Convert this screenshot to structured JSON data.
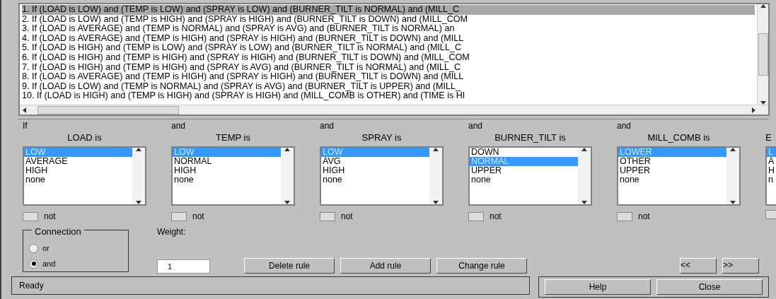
{
  "rules": [
    {
      "text": "1. If (LOAD is LOW) and (TEMP is LOW) and (SPRAY is LOW) and (BURNER_TILT is NORMAL) and (MILL_C",
      "selected": true
    },
    {
      "text": "2. If (LOAD is LOW) and (TEMP is HIGH) and (SPRAY is HIGH) and (BURNER_TILT is DOWN) and (MILL_COM",
      "selected": false
    },
    {
      "text": "3. If (LOAD is AVERAGE) and (TEMP is NORMAL) and (SPRAY is AVG) and (BURNER_TILT is NORMAL) an",
      "selected": false
    },
    {
      "text": "4. If (LOAD is AVERAGE) and (TEMP is HIGH) and (SPRAY is HIGH) and (BURNER_TILT is DOWN) and (MILL",
      "selected": false
    },
    {
      "text": "5. If (LOAD is HIGH) and (TEMP is LOW) and (SPRAY is LOW) and (BURNER_TILT is NORMAL) and (MILL_C",
      "selected": false
    },
    {
      "text": "6. If (LOAD is HIGH) and (TEMP is HIGH) and (SPRAY is HIGH) and (BURNER_TILT is DOWN) and (MILL_COM",
      "selected": false
    },
    {
      "text": "7. If (LOAD is HIGH) and (TEMP is HIGH) and (SPRAY is AVG) and (BURNER_TILT is NORMAL) and (MILL_C",
      "selected": false
    },
    {
      "text": "8. If (LOAD is AVERAGE) and (TEMP is HIGH) and (SPRAY is HIGH) and (BURNER_TILT is DOWN) and (MILL",
      "selected": false
    },
    {
      "text": "9. If (LOAD is LOW) and (TEMP is NORMAL) and (SPRAY is AVG) and (BURNER_TILT is UPPER) and (MILL_",
      "selected": false
    },
    {
      "text": "10. If (LOAD is HIGH) and (TEMP is HIGH) and (SPRAY is HIGH) and (MILL_COMB is OTHER) and (TIME is HI",
      "selected": false
    }
  ],
  "inputs": [
    {
      "connector": "If",
      "label": "LOAD is",
      "options": [
        {
          "text": "LOW",
          "selected": true
        },
        {
          "text": "AVERAGE",
          "selected": false
        },
        {
          "text": "HIGH",
          "selected": false
        },
        {
          "text": "none",
          "selected": false
        }
      ],
      "not_label": "not",
      "not": false
    },
    {
      "connector": "and",
      "label": "TEMP is",
      "options": [
        {
          "text": "LOW",
          "selected": true
        },
        {
          "text": "NORMAL",
          "selected": false
        },
        {
          "text": "HIGH",
          "selected": false
        },
        {
          "text": "none",
          "selected": false
        }
      ],
      "not_label": "not",
      "not": false
    },
    {
      "connector": "and",
      "label": "SPRAY is",
      "options": [
        {
          "text": "LOW",
          "selected": true
        },
        {
          "text": "AVG",
          "selected": false
        },
        {
          "text": "HIGH",
          "selected": false
        },
        {
          "text": "none",
          "selected": false
        }
      ],
      "not_label": "not",
      "not": false
    },
    {
      "connector": "and",
      "label": "BURNER_TILT is",
      "options": [
        {
          "text": "DOWN",
          "selected": false
        },
        {
          "text": "NORMAL",
          "selected": true
        },
        {
          "text": "UPPER",
          "selected": false
        },
        {
          "text": "none",
          "selected": false
        }
      ],
      "not_label": "not",
      "not": false
    },
    {
      "connector": "and",
      "label": "MILL_COMB is",
      "options": [
        {
          "text": "LOWER",
          "selected": true
        },
        {
          "text": "OTHER",
          "selected": false
        },
        {
          "text": "UPPER",
          "selected": false
        },
        {
          "text": "none",
          "selected": false
        }
      ],
      "not_label": "not",
      "not": false
    },
    {
      "label": "E",
      "options": [
        {
          "text": "L",
          "selected": true
        },
        {
          "text": "A",
          "selected": false
        },
        {
          "text": "H",
          "selected": false
        },
        {
          "text": "n",
          "selected": false
        }
      ],
      "not": false
    }
  ],
  "connection": {
    "title": "Connection",
    "options": [
      {
        "label": "or",
        "selected": false
      },
      {
        "label": "and",
        "selected": true
      }
    ]
  },
  "weight": {
    "label": "Weight:",
    "value": "1"
  },
  "buttons": [
    "Delete rule",
    "Add rule",
    "Change rule"
  ],
  "nav_buttons": [
    "<<",
    ">>"
  ],
  "status": "Ready",
  "footer_buttons": [
    "Help",
    "Close"
  ]
}
